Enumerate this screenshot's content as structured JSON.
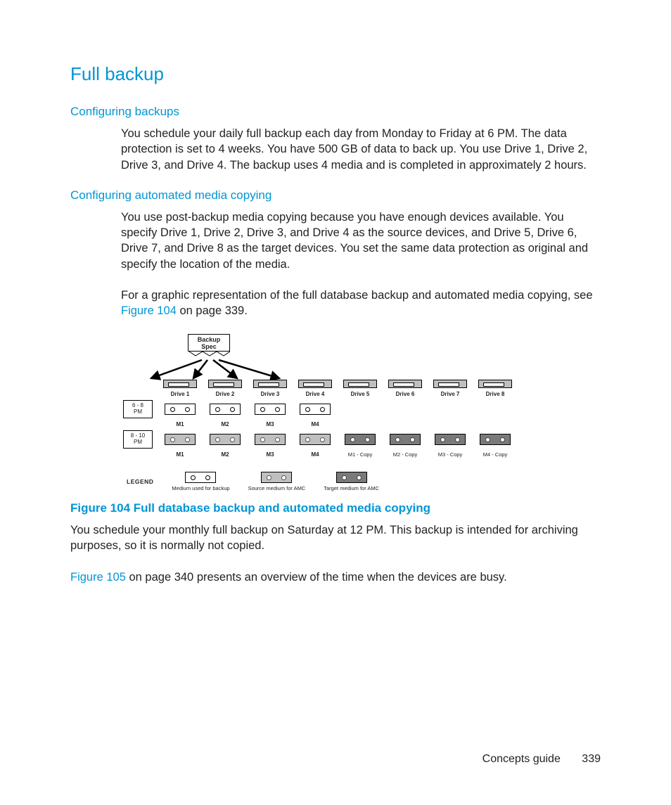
{
  "title": "Full backup",
  "sections": {
    "configuring_backups": {
      "heading": "Configuring backups",
      "body": "You schedule your daily full backup each day from Monday to Friday at 6 PM. The data protection is set to 4 weeks. You have 500 GB of data to back up. You use Drive 1, Drive 2, Drive 3, and Drive 4. The backup uses 4 media and is completed in approximately 2 hours."
    },
    "configuring_amc": {
      "heading": "Configuring automated media copying",
      "body1": "You use post-backup media copying because you have enough devices available. You specify Drive 1, Drive 2, Drive 3, and Drive 4 as the source devices, and Drive 5, Drive 6, Drive 7, and Drive 8 as the target devices. You set the same data protection as original and specify the location of the media.",
      "body2_pre": "For a graphic representation of the full database backup and automated media copying, see ",
      "body2_link": "Figure 104",
      "body2_post": " on page 339."
    }
  },
  "figure": {
    "spec_label": "Backup\nSpec",
    "drives": [
      "Drive 1",
      "Drive 2",
      "Drive 3",
      "Drive 4",
      "Drive 5",
      "Drive 6",
      "Drive 7",
      "Drive 8"
    ],
    "time1": "6 - 8\nPM",
    "time2": "8 - 10\nPM",
    "row1_media": [
      "M1",
      "M2",
      "M3",
      "M4"
    ],
    "row2_media": [
      "M1",
      "M2",
      "M3",
      "M4"
    ],
    "row2_copies": [
      "M1 - Copy",
      "M2 - Copy",
      "M3 - Copy",
      "M4 - Copy"
    ],
    "legend_label": "LEGEND",
    "legend_items": [
      "Medium used for backup",
      "Source medium for AMC",
      "Target medium for AMC"
    ],
    "caption": "Figure 104 Full database backup and automated media copying"
  },
  "post_figure": {
    "body1": "You schedule your monthly full backup on Saturday at 12 PM. This backup is intended for archiving purposes, so it is normally not copied.",
    "body2_link": "Figure 105",
    "body2_post": " on page 340 presents an overview of the time when the devices are busy."
  },
  "footer": {
    "label": "Concepts guide",
    "page": "339"
  }
}
